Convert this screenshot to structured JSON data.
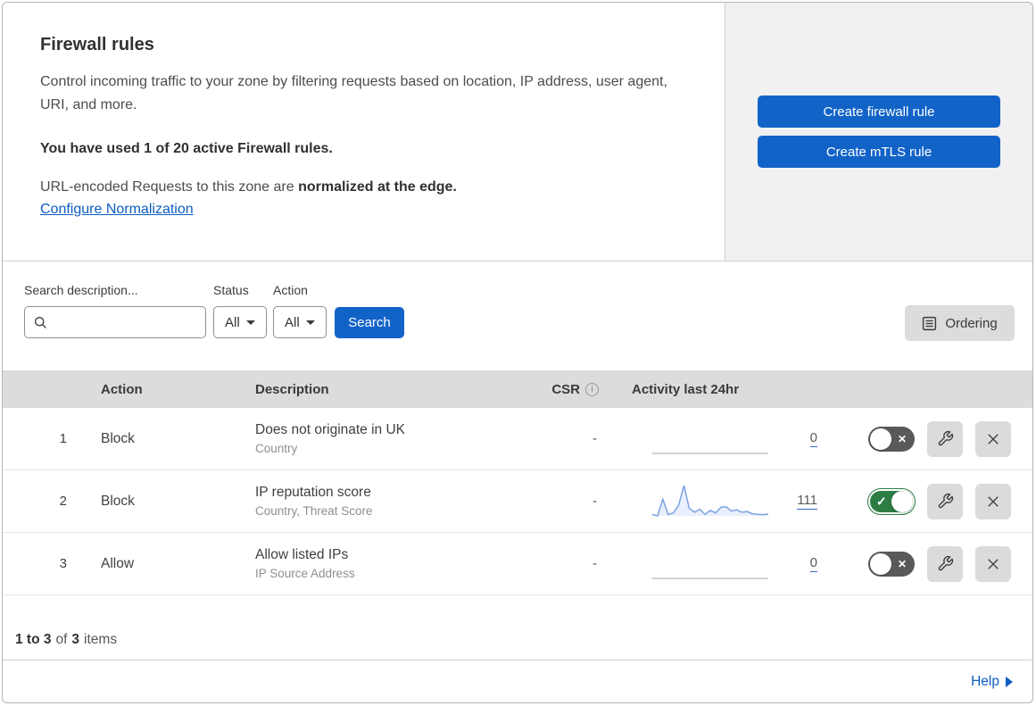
{
  "header": {
    "title": "Firewall rules",
    "description": "Control incoming traffic to your zone by filtering requests based on location, IP address, user agent, URI, and more.",
    "usage_note": "You have used 1 of 20 active Firewall rules.",
    "normalization_text": "URL-encoded Requests to this zone are",
    "normalization_bold": "normalized at the edge.",
    "normalization_link": "Configure Normalization",
    "create_firewall_button": "Create firewall rule",
    "create_mtls_button": "Create mTLS rule"
  },
  "filters": {
    "search_label": "Search description...",
    "status_label": "Status",
    "status_value": "All",
    "action_label": "Action",
    "action_value": "All",
    "search_button": "Search",
    "ordering_button": "Ordering"
  },
  "table": {
    "headers": {
      "action": "Action",
      "description": "Description",
      "csr": "CSR",
      "activity": "Activity last 24hr"
    },
    "rows": [
      {
        "priority": "1",
        "action": "Block",
        "description": "Does not originate in UK",
        "criteria": "Country",
        "csr": "-",
        "activity_count": "0",
        "enabled": false,
        "sparkline": []
      },
      {
        "priority": "2",
        "action": "Block",
        "description": "IP reputation score",
        "criteria": "Country, Threat Score",
        "csr": "-",
        "activity_count": "111",
        "enabled": true,
        "sparkline": [
          5,
          0,
          55,
          5,
          10,
          35,
          100,
          25,
          12,
          22,
          5,
          18,
          10,
          28,
          30,
          16,
          20,
          12,
          14,
          7,
          5,
          4,
          6
        ]
      },
      {
        "priority": "3",
        "action": "Allow",
        "description": "Allow listed IPs",
        "criteria": "IP Source Address",
        "csr": "-",
        "activity_count": "0",
        "enabled": false,
        "sparkline": []
      }
    ]
  },
  "footer": {
    "range": "1 to 3",
    "of_label": "of",
    "total": "3",
    "items_label": "items"
  },
  "help": {
    "label": "Help"
  },
  "icons": {
    "toggle_check": "✓",
    "toggle_cross": "✕",
    "info": "i"
  },
  "colors": {
    "primary_blue": "#1263c8",
    "link_blue": "#0d5dc2",
    "toggle_on_green": "#2c7c44",
    "toggle_off_gray": "#595959",
    "table_header_gray": "#dcdcdc",
    "panel_gray": "#f1f1f1",
    "control_gray": "#dbdbdb",
    "sparkline_blue": "#7ba3e3",
    "sparkline_fill": "#e9effc",
    "sparkline_empty": "#c4c4c4"
  }
}
